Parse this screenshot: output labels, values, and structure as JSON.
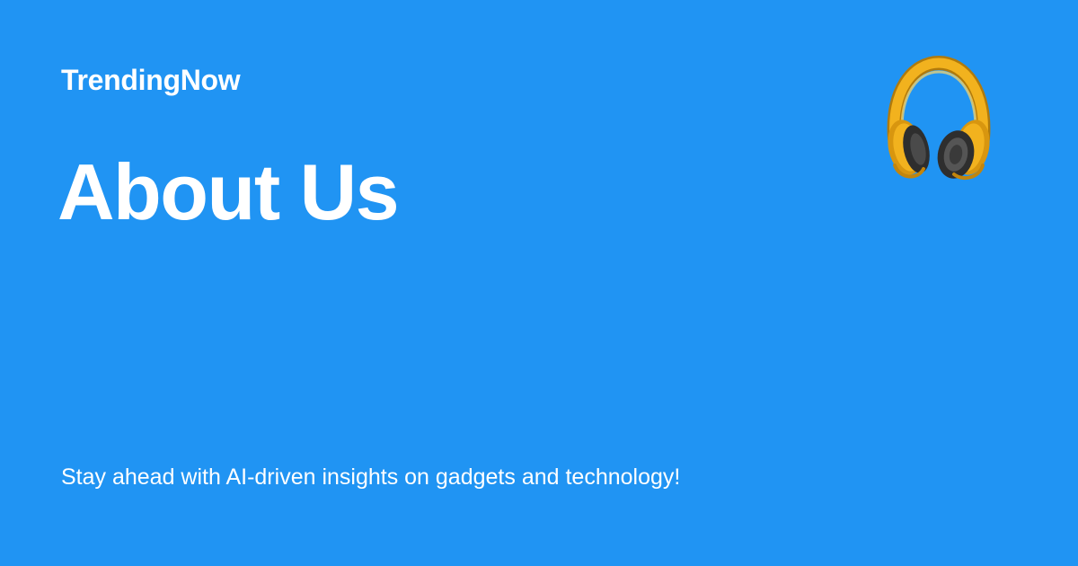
{
  "card": {
    "brand": "TrendingNow",
    "title": "About Us",
    "tagline": "Stay ahead with AI-driven insights on gadgets and technology!",
    "icon": "headphones-icon",
    "colors": {
      "background": "#2094F3",
      "text": "#FFFFFF",
      "icon_accent": "#F2B21E",
      "icon_dark": "#3A3A3A"
    }
  }
}
